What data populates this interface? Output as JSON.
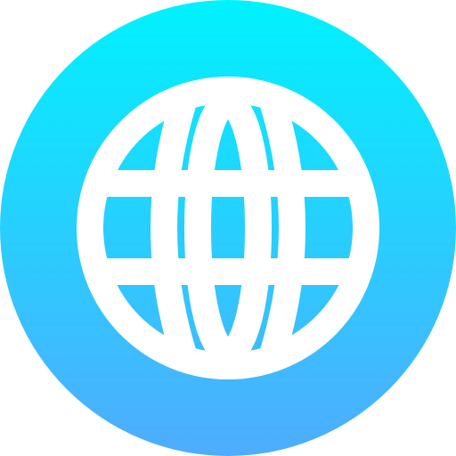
{
  "icon": {
    "name": "globe-icon",
    "gradient_top": "#00F2FE",
    "gradient_bottom": "#4FACFE",
    "stroke_color": "#FFFFFF"
  }
}
